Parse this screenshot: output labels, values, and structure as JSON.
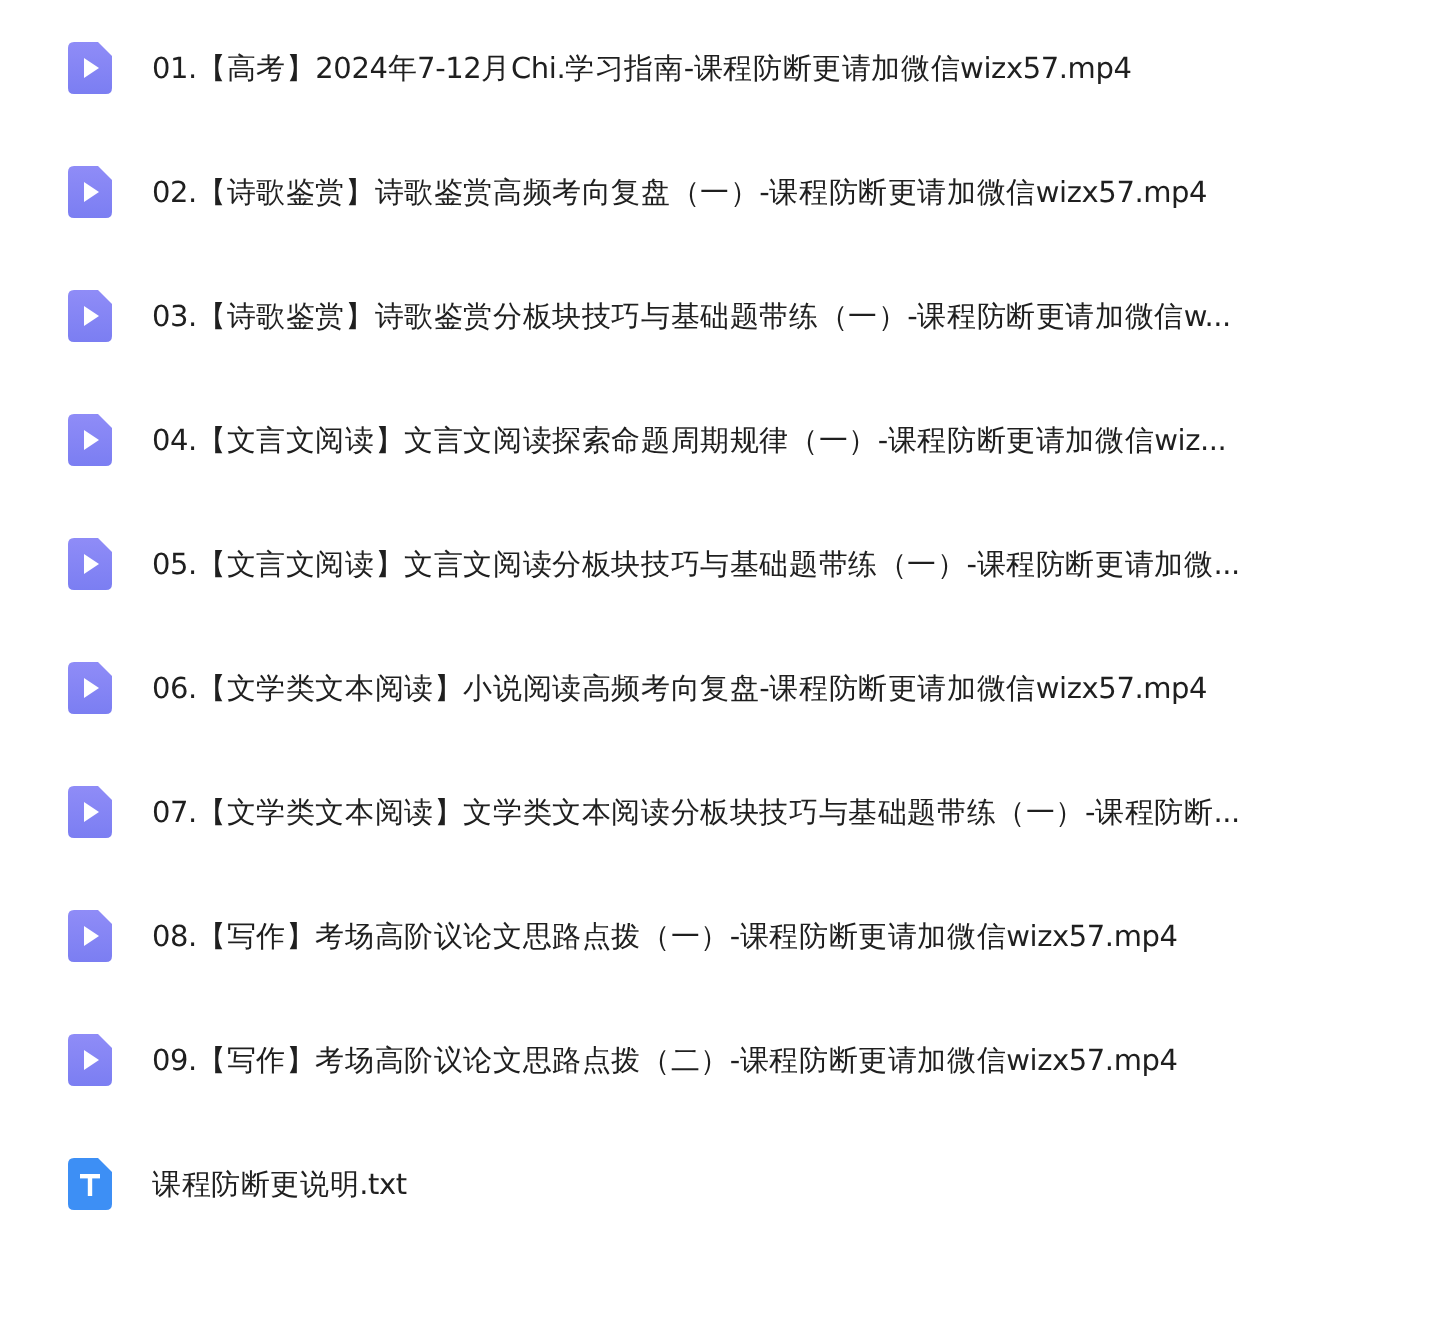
{
  "files": [
    {
      "kind": "video",
      "name": "01.【高考】2024年7-12月Chi.学习指南-课程防断更请加微信wizx57.mp4"
    },
    {
      "kind": "video",
      "name": "02.【诗歌鉴赏】诗歌鉴赏高频考向复盘（一）-课程防断更请加微信wizx57.mp4"
    },
    {
      "kind": "video",
      "name": "03.【诗歌鉴赏】诗歌鉴赏分板块技巧与基础题带练（一）-课程防断更请加微信w..."
    },
    {
      "kind": "video",
      "name": "04.【文言文阅读】文言文阅读探索命题周期规律（一）-课程防断更请加微信wiz..."
    },
    {
      "kind": "video",
      "name": "05.【文言文阅读】文言文阅读分板块技巧与基础题带练（一）-课程防断更请加微..."
    },
    {
      "kind": "video",
      "name": "06.【文学类文本阅读】小说阅读高频考向复盘-课程防断更请加微信wizx57.mp4"
    },
    {
      "kind": "video",
      "name": "07.【文学类文本阅读】文学类文本阅读分板块技巧与基础题带练（一）-课程防断..."
    },
    {
      "kind": "video",
      "name": "08.【写作】考场高阶议论文思路点拨（一）-课程防断更请加微信wizx57.mp4"
    },
    {
      "kind": "video",
      "name": "09.【写作】考场高阶议论文思路点拨（二）-课程防断更请加微信wizx57.mp4"
    },
    {
      "kind": "text",
      "name": "课程防断更说明.txt"
    }
  ]
}
